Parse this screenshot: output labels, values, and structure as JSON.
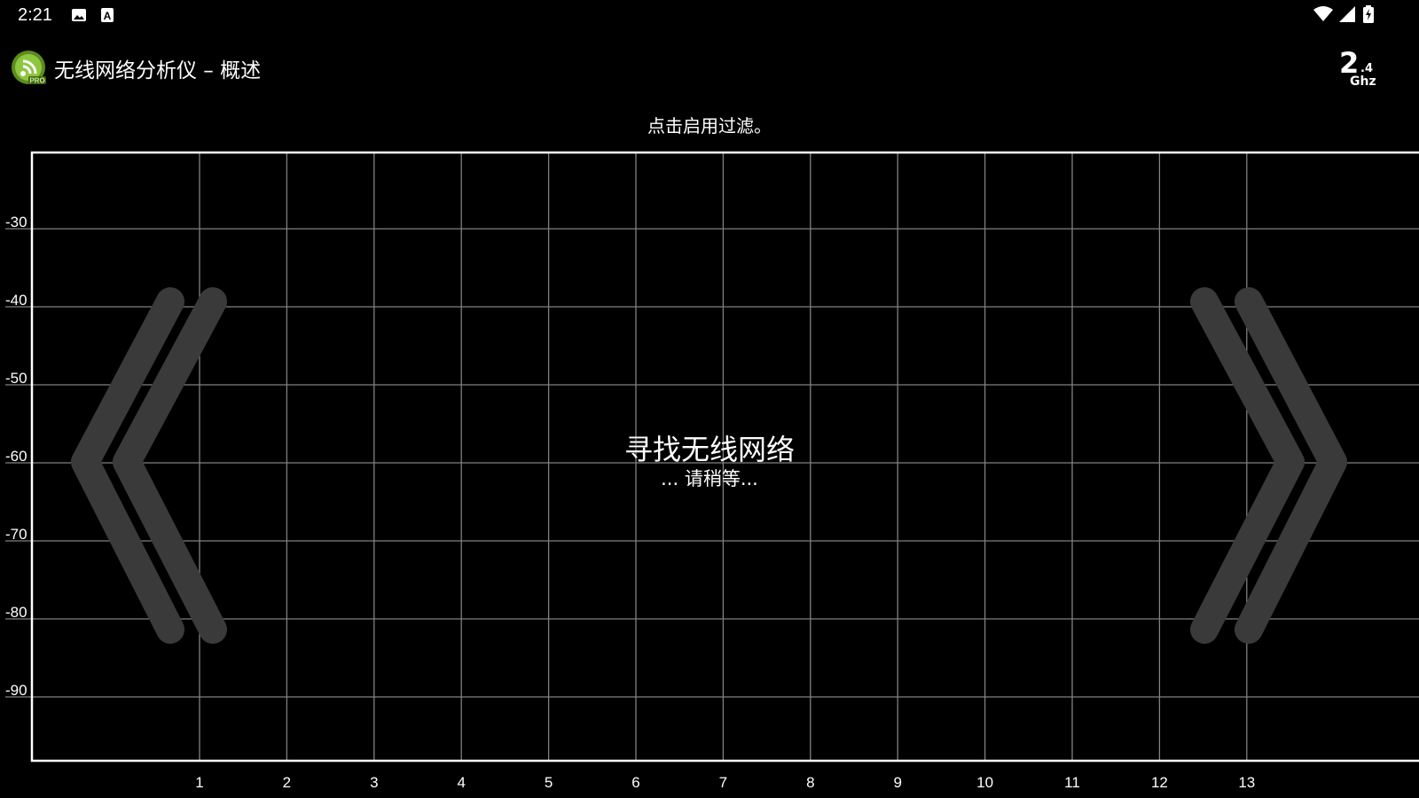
{
  "status_bar": {
    "time": "2:21",
    "icons": [
      "image-icon",
      "keyboard-a-icon",
      "wifi-icon",
      "cell-signal-icon",
      "battery-charging-icon"
    ]
  },
  "app_bar": {
    "title": "无线网络分析仪 – 概述",
    "logo": "wifi-analyzer-pro-logo",
    "band_main": "2",
    "band_fraction": ".4",
    "band_unit": "Ghz"
  },
  "filter_hint": "点击启用过滤。",
  "chart_data": {
    "type": "line",
    "y_ticks": [
      "-30",
      "-40",
      "-50",
      "-60",
      "-70",
      "-80",
      "-90"
    ],
    "x_ticks": [
      "1",
      "2",
      "3",
      "4",
      "5",
      "6",
      "7",
      "8",
      "9",
      "10",
      "11",
      "12",
      "13"
    ],
    "ylim": [
      -100,
      -20
    ],
    "xlim": [
      -1,
      15
    ],
    "grid": true,
    "series": []
  },
  "scan_status": {
    "title": "寻找无线网络",
    "subtitle": "... 请稍等..."
  },
  "nav": {
    "prev_icon": "double-chevron-left-icon",
    "next_icon": "double-chevron-right-icon"
  },
  "colors": {
    "background": "#000000",
    "grid": "#808080",
    "frame": "#ffffff",
    "chevron": "#3a3a3a",
    "logo_green": "#8dc63f"
  }
}
